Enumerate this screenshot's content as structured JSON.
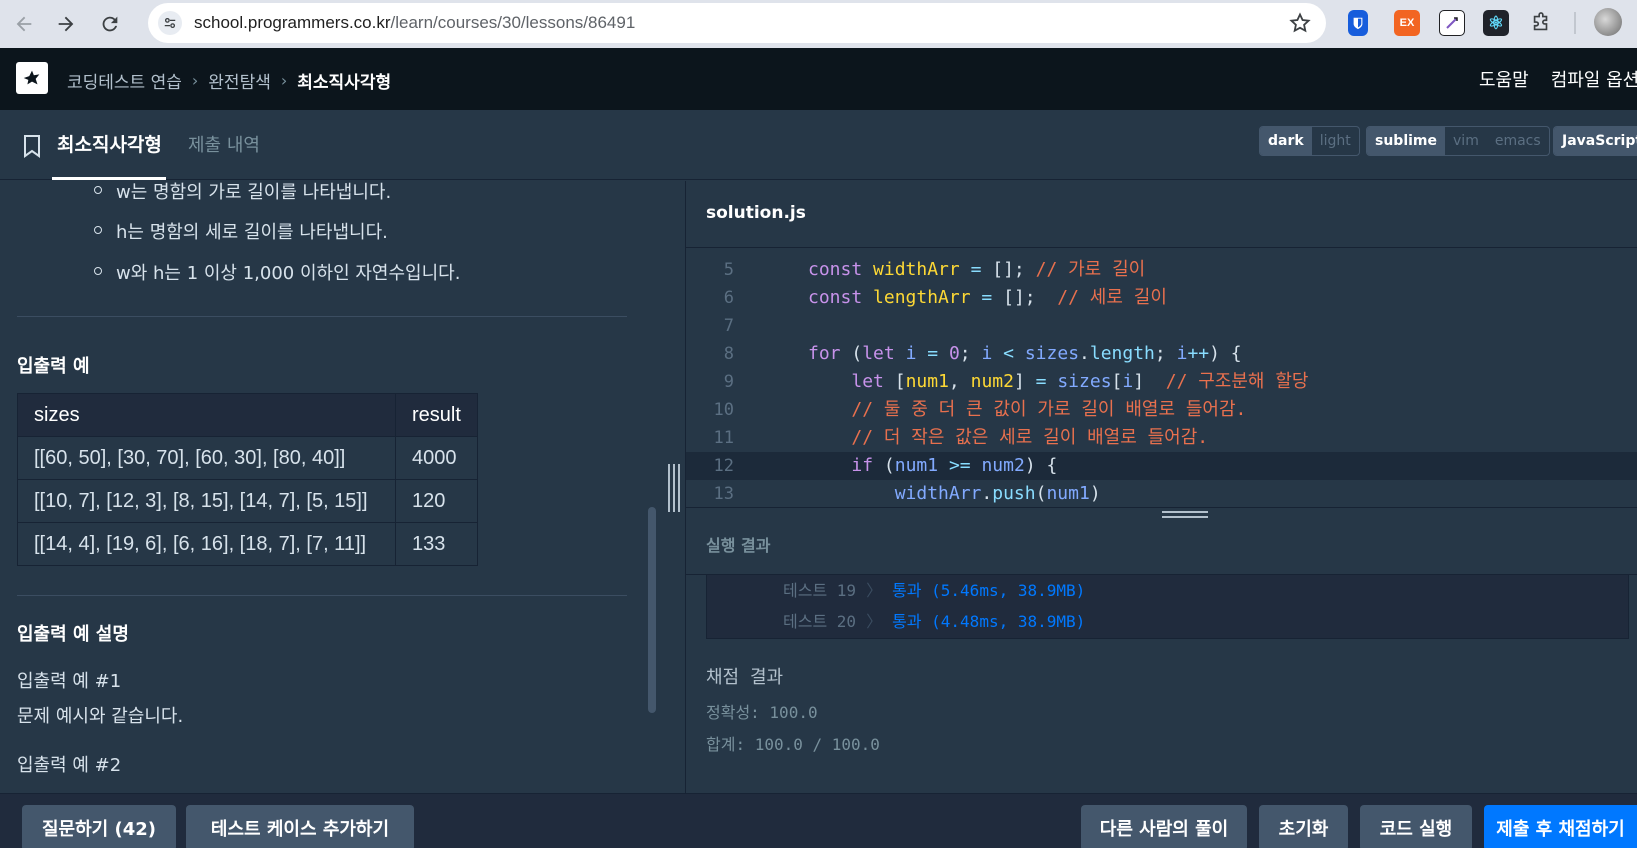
{
  "browser": {
    "url_host": "school.programmers.co.kr",
    "url_path": "/learn/courses/30/lessons/86491",
    "extensions": [
      {
        "name": "bitwarden-icon",
        "glyph": "",
        "bg": "#175ddc"
      },
      {
        "name": "ex-extension-icon",
        "glyph": "EX",
        "bg": "#f26522"
      },
      {
        "name": "notes-extension-icon",
        "glyph": "",
        "bg": "#ffffff"
      },
      {
        "name": "react-devtools-icon",
        "glyph": "⚛",
        "bg": "#20232a"
      },
      {
        "name": "puzzle-icon",
        "glyph": "",
        "bg": "transparent"
      }
    ]
  },
  "header": {
    "breadcrumb": [
      "코딩테스트 연습",
      "완전탐색",
      "최소직사각형"
    ],
    "links": [
      "도움말",
      "컴파일 옵션"
    ]
  },
  "tabs": {
    "active": "최소직사각형",
    "inactive": "제출 내역"
  },
  "toggles": {
    "theme": [
      "dark",
      "light"
    ],
    "keymap": [
      "sublime",
      "vim",
      "emacs"
    ],
    "language": "JavaScript"
  },
  "problem": {
    "bullets": [
      "w는 명함의 가로 길이를 나타냅니다.",
      "h는 명함의 세로 길이를 나타냅니다.",
      "w와 h는 1 이상 1,000 이하인 자연수입니다."
    ],
    "io_title": "입출력 예",
    "io_table": {
      "headers": [
        "sizes",
        "result"
      ],
      "rows": [
        [
          "[[60, 50], [30, 70], [60, 30], [80, 40]]",
          "4000"
        ],
        [
          "[[10, 7], [12, 3], [8, 15], [14, 7], [5, 15]]",
          "120"
        ],
        [
          "[[14, 4], [19, 6], [6, 16], [18, 7], [7, 11]]",
          "133"
        ]
      ]
    },
    "explain_title": "입출력 예 설명",
    "explain_1_title": "입출력 예 #1",
    "explain_1_text": "문제 예시와 같습니다.",
    "explain_2_title": "입출력 예 #2"
  },
  "editor": {
    "filename": "solution.js",
    "line_numbers": [
      "5",
      "6",
      "7",
      "8",
      "9",
      "10",
      "11",
      "12",
      "13"
    ]
  },
  "result": {
    "title": "실행 결과",
    "tests": [
      {
        "label": "테스트 19",
        "arrow": "〉",
        "status": "통과 (5.46ms, 38.9MB)"
      },
      {
        "label": "테스트 20",
        "arrow": "〉",
        "status": "통과 (4.48ms, 38.9MB)"
      }
    ],
    "grade_title": "채점 결과",
    "accuracy": "정확성: 100.0",
    "total": "합계: 100.0 / 100.0"
  },
  "bottom": {
    "question": "질문하기 (42)",
    "add_test": "테스트 케이스 추가하기",
    "others": "다른 사람의 풀이",
    "reset": "초기화",
    "run": "코드 실행",
    "submit": "제출 후 채점하기"
  }
}
